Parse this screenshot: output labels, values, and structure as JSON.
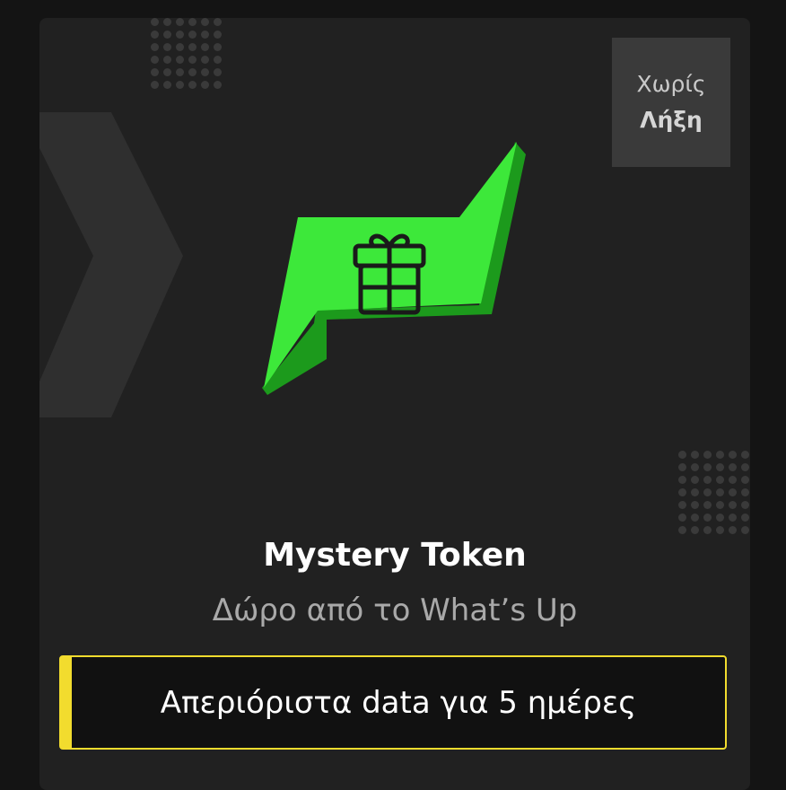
{
  "badge": {
    "line1": "Χωρίς",
    "line2": "Λήξη"
  },
  "token": {
    "title": "Mystery Token",
    "subtitle": "Δώρο από το What’s Up",
    "icon": "gift-icon"
  },
  "offer": {
    "text": "Απεριόριστα data για 5 ημέρες"
  },
  "colors": {
    "accent_green": "#3de83a",
    "accent_yellow": "#f2dc2e",
    "card_bg": "#212121"
  }
}
